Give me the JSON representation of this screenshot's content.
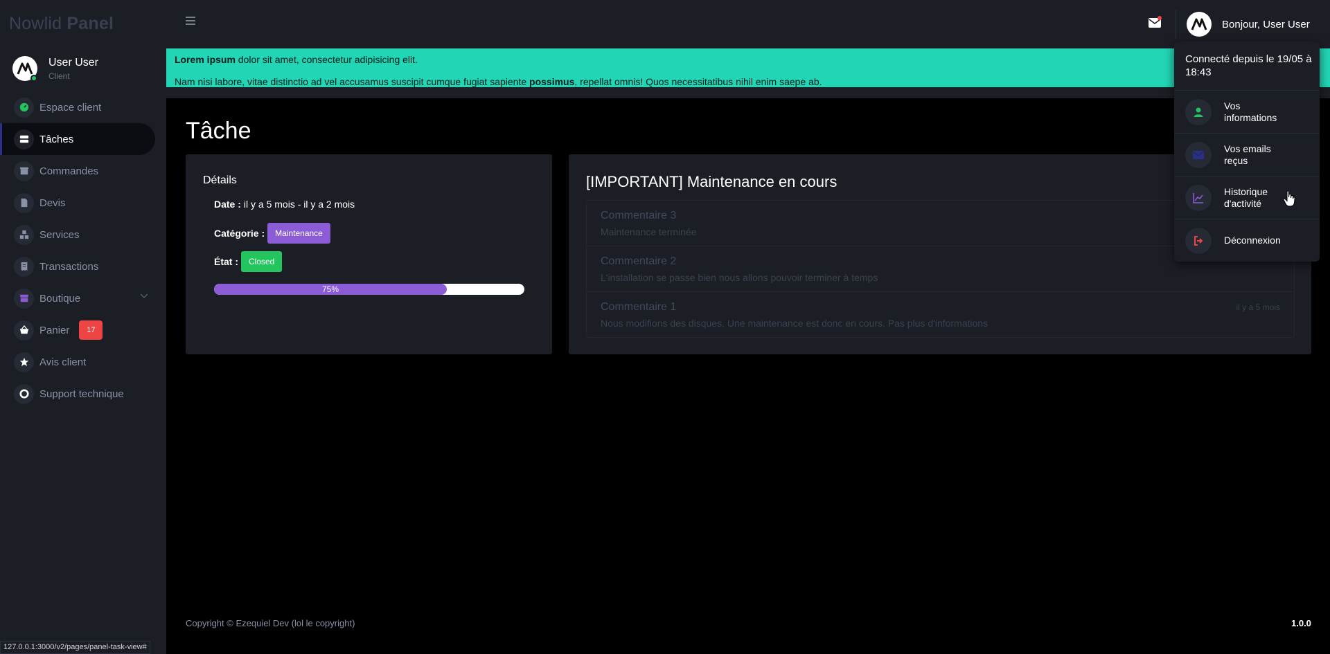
{
  "app": {
    "brand_regular": "Nowlid",
    "brand_bold": "Panel"
  },
  "user": {
    "name": "User User",
    "role": "Client",
    "online": true
  },
  "sidebar": {
    "items": [
      {
        "label": "Espace client",
        "icon": "dashboard-icon",
        "color": "#22c55e"
      },
      {
        "label": "Tâches",
        "icon": "tasks-icon",
        "active": true
      },
      {
        "label": "Commandes",
        "icon": "box-icon"
      },
      {
        "label": "Devis",
        "icon": "file-icon"
      },
      {
        "label": "Services",
        "icon": "cubes-icon"
      },
      {
        "label": "Transactions",
        "icon": "receipt-icon"
      },
      {
        "label": "Boutique",
        "icon": "store-icon",
        "color": "#8b5cd6",
        "expandable": true
      },
      {
        "label": "Panier",
        "icon": "basket-icon",
        "badge": "17"
      },
      {
        "label": "Avis client",
        "icon": "star-icon"
      },
      {
        "label": "Support technique",
        "icon": "lifebuoy-icon"
      }
    ]
  },
  "header": {
    "greeting": "Bonjour, User User",
    "has_new_mail": true
  },
  "banner": {
    "line1_bold": "Lorem ipsum",
    "line1_rest": " dolor sit amet, consectetur adipisicing elit.",
    "line2_start": "Nam nisi labore, vitae distinctio ad vel accusamus suscipit cumque fugiat sapiente ",
    "line2_bold": "possimus",
    "line2_end": ", repellat omnis! Quos necessitatibus nihil enim saepe ab.",
    "color": "#22d6b5"
  },
  "page": {
    "title": "Tâche"
  },
  "details": {
    "title": "Détails",
    "date_label": "Date :",
    "date_value": "il y a 5 mois - il y a 2 mois",
    "category_label": "Catégorie :",
    "category_value": "Maintenance",
    "state_label": "État :",
    "state_value": "Closed",
    "progress": 75,
    "progress_text": "75%"
  },
  "task": {
    "title": "[IMPORTANT] Maintenance en cours",
    "comments": [
      {
        "title": "Commentaire 3",
        "body": "Maintenance terminée",
        "time": ""
      },
      {
        "title": "Commentaire 2",
        "body": "L'installation se passe bien nous allons pouvoir terminer à temps",
        "time": ""
      },
      {
        "title": "Commentaire 1",
        "body": "Nous modifions des disques. Une maintenance est donc en cours. Pas plus d'informations",
        "time": "il y a 5 mois"
      }
    ]
  },
  "dropdown": {
    "header": "Connecté depuis le 19/05 à 18:43",
    "items": [
      {
        "label": "Vos informations",
        "icon": "user-icon",
        "color": "#22c55e"
      },
      {
        "label": "Vos emails reçus",
        "icon": "envelope-icon",
        "color": "#2a2f8a"
      },
      {
        "label": "Historique d'activité",
        "icon": "chart-line-icon",
        "color": "#8b5cd6"
      },
      {
        "label": "Déconnexion",
        "icon": "sign-out-icon",
        "color": "#ef4444"
      }
    ]
  },
  "footer": {
    "copyright": "Copyright © Ezequiel Dev (lol le copyright)",
    "version": "1.0.0"
  },
  "statusbar": {
    "url": "127.0.0.1:3000/v2/pages/panel-task-view#"
  }
}
